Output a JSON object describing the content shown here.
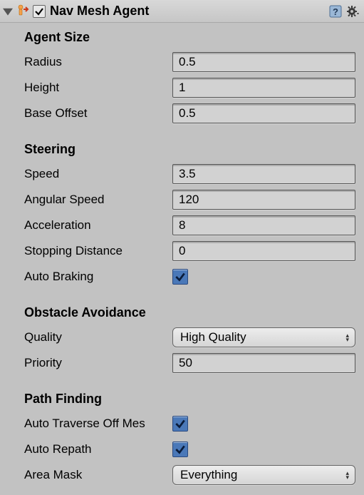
{
  "header": {
    "title": "Nav Mesh Agent",
    "enabled": true
  },
  "sections": {
    "agentSize": {
      "title": "Agent Size",
      "radius_label": "Radius",
      "radius_value": "0.5",
      "height_label": "Height",
      "height_value": "1",
      "baseOffset_label": "Base Offset",
      "baseOffset_value": "0.5"
    },
    "steering": {
      "title": "Steering",
      "speed_label": "Speed",
      "speed_value": "3.5",
      "angularSpeed_label": "Angular Speed",
      "angularSpeed_value": "120",
      "acceleration_label": "Acceleration",
      "acceleration_value": "8",
      "stoppingDistance_label": "Stopping Distance",
      "stoppingDistance_value": "0",
      "autoBraking_label": "Auto Braking",
      "autoBraking_checked": true
    },
    "obstacle": {
      "title": "Obstacle Avoidance",
      "quality_label": "Quality",
      "quality_value": "High Quality",
      "priority_label": "Priority",
      "priority_value": "50"
    },
    "pathFinding": {
      "title": "Path Finding",
      "autoTraverse_label": "Auto Traverse Off Mes",
      "autoTraverse_checked": true,
      "autoRepath_label": "Auto Repath",
      "autoRepath_checked": true,
      "areaMask_label": "Area Mask",
      "areaMask_value": "Everything"
    }
  }
}
